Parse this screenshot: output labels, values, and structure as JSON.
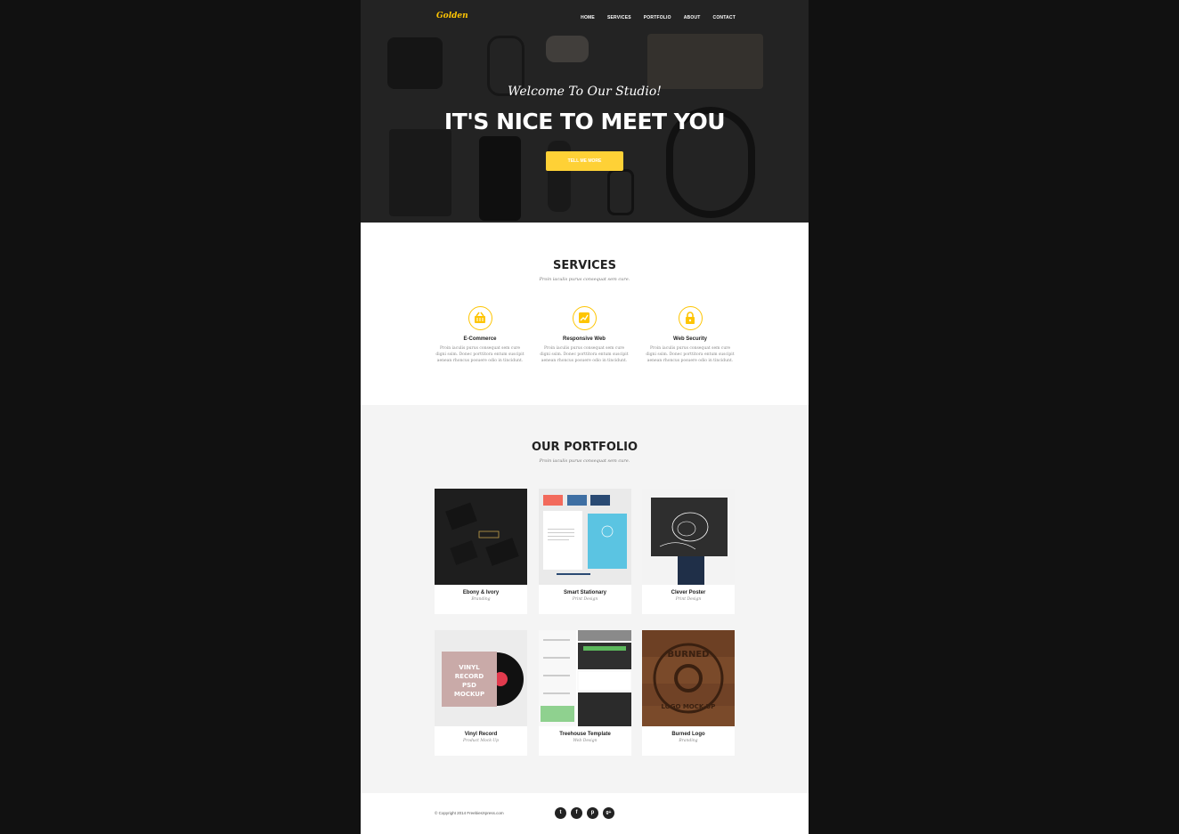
{
  "brand": {
    "logo": "Golden",
    "accent_color": "#fed136"
  },
  "nav": {
    "items": [
      "HOME",
      "SERVICES",
      "PORTFOLIO",
      "ABOUT",
      "CONTACT"
    ]
  },
  "hero": {
    "subtitle": "Welcome To Our Studio!",
    "title": "IT'S NICE TO MEET YOU",
    "button_label": "TELL ME MORE"
  },
  "services": {
    "title": "SERVICES",
    "subtitle": "Proin iaculis purus consequat sem cure.",
    "items": [
      {
        "name": "E-Commerce",
        "icon": "shopping-basket-icon",
        "description": "Proin iaculis purus consequat sem cure digni ssim. Donec porttitora entum suscipit aenean rhoncus posuere odio in tincidunt."
      },
      {
        "name": "Responsive Web",
        "icon": "chart-screen-icon",
        "description": "Proin iaculis purus consequat sem cure digni ssim. Donec porttitora entum suscipit aenean rhoncus posuere odio in tincidunt."
      },
      {
        "name": "Web Security",
        "icon": "lock-icon",
        "description": "Proin iaculis purus consequat sem cure digni ssim. Donec porttitora entum suscipit aenean rhoncus posuere odio in tincidunt."
      }
    ]
  },
  "portfolio": {
    "title": "OUR PORTFOLIO",
    "subtitle": "Proin iaculis purus consequat sem cure.",
    "items": [
      {
        "title": "Ebony & Ivory",
        "category": "Branding"
      },
      {
        "title": "Smart Stationary",
        "category": "Print Design"
      },
      {
        "title": "Clever Poster",
        "category": "Print Design"
      },
      {
        "title": "Vinyl Record",
        "category": "Product Mock-Up"
      },
      {
        "title": "Treehouse Template",
        "category": "Web Design"
      },
      {
        "title": "Burned Logo",
        "category": "Branding"
      }
    ],
    "image_text": {
      "vinyl": [
        "VINYL",
        "RECORD",
        "PSD",
        "MOCKUP"
      ],
      "burned": [
        "BURNED",
        "LOGO MOCK-UP"
      ]
    }
  },
  "footer": {
    "copyright": "© Copyright 2014 FreebiesXpress.com",
    "social": [
      {
        "icon": "twitter-icon",
        "glyph": "t"
      },
      {
        "icon": "facebook-icon",
        "glyph": "f"
      },
      {
        "icon": "pinterest-icon",
        "glyph": "p"
      },
      {
        "icon": "google-plus-icon",
        "glyph": "g+"
      }
    ]
  }
}
